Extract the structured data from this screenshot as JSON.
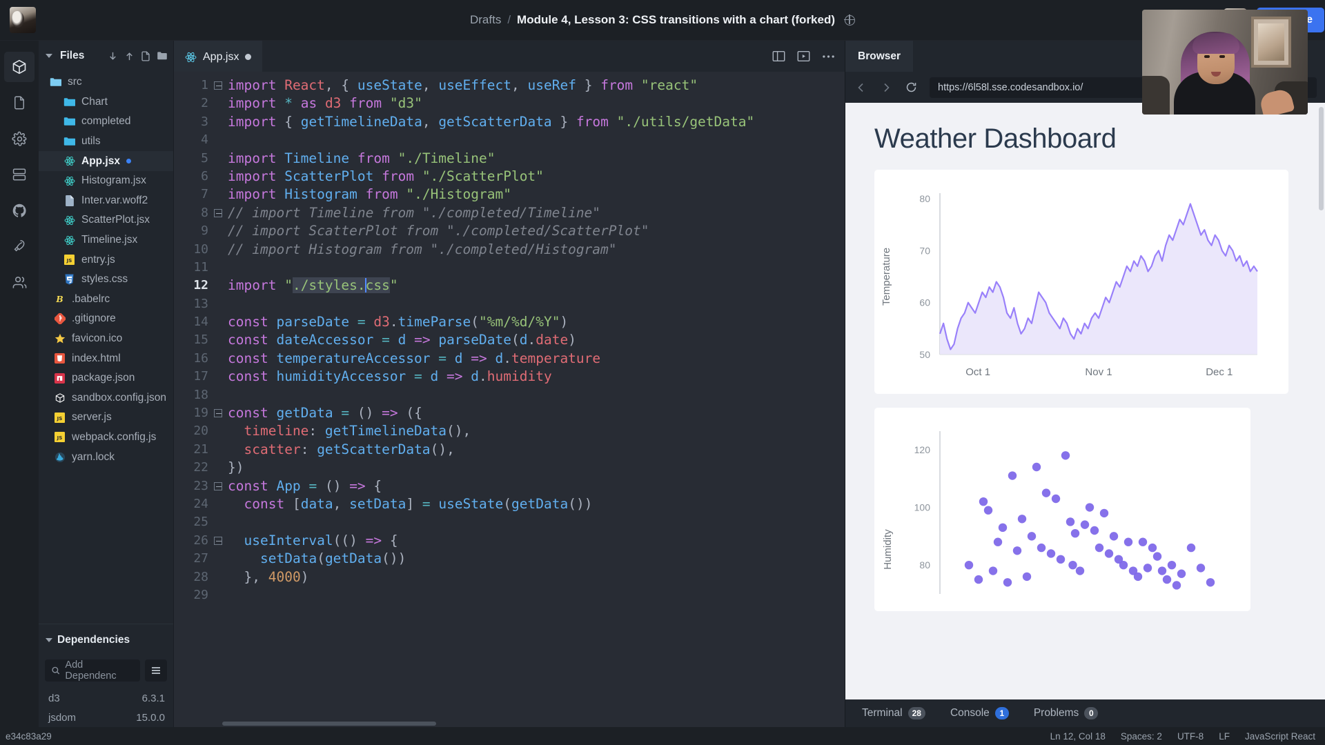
{
  "topbar": {
    "breadcrumb_root": "Drafts",
    "breadcrumb_sep": "/",
    "breadcrumb_title": "Module 4, Lesson 3: CSS transitions with a chart (forked)",
    "share_label": "Share"
  },
  "activitybar": {
    "items": [
      {
        "name": "sandbox-explorer-icon",
        "active": true
      },
      {
        "name": "files-icon",
        "active": false
      },
      {
        "name": "settings-gear-icon",
        "active": false
      },
      {
        "name": "server-control-icon",
        "active": false
      },
      {
        "name": "github-icon",
        "active": false
      },
      {
        "name": "deploy-rocket-icon",
        "active": false
      },
      {
        "name": "live-collaborators-icon",
        "active": false
      }
    ]
  },
  "sidebar": {
    "title": "Files",
    "actions": [
      "download-icon",
      "upload-icon",
      "new-file-icon",
      "new-folder-icon"
    ],
    "files": [
      {
        "label": "src",
        "icon": "folder-open",
        "indent": 0,
        "selected": false,
        "modified": false
      },
      {
        "label": "Chart",
        "icon": "folder",
        "indent": 1,
        "selected": false,
        "modified": false
      },
      {
        "label": "completed",
        "icon": "folder",
        "indent": 1,
        "selected": false,
        "modified": false
      },
      {
        "label": "utils",
        "icon": "folder",
        "indent": 1,
        "selected": false,
        "modified": false
      },
      {
        "label": "App.jsx",
        "icon": "react",
        "indent": 1,
        "selected": true,
        "modified": true
      },
      {
        "label": "Histogram.jsx",
        "icon": "react",
        "indent": 1,
        "selected": false,
        "modified": false
      },
      {
        "label": "Inter.var.woff2",
        "icon": "file",
        "indent": 1,
        "selected": false,
        "modified": false
      },
      {
        "label": "ScatterPlot.jsx",
        "icon": "react",
        "indent": 1,
        "selected": false,
        "modified": false
      },
      {
        "label": "Timeline.jsx",
        "icon": "react",
        "indent": 1,
        "selected": false,
        "modified": false
      },
      {
        "label": "entry.js",
        "icon": "js",
        "indent": 1,
        "selected": false,
        "modified": false
      },
      {
        "label": "styles.css",
        "icon": "css",
        "indent": 1,
        "selected": false,
        "modified": false
      },
      {
        "label": ".babelrc",
        "icon": "babel",
        "indent": 2,
        "selected": false,
        "modified": false
      },
      {
        "label": ".gitignore",
        "icon": "git",
        "indent": 2,
        "selected": false,
        "modified": false
      },
      {
        "label": "favicon.ico",
        "icon": "star",
        "indent": 2,
        "selected": false,
        "modified": false
      },
      {
        "label": "index.html",
        "icon": "html",
        "indent": 2,
        "selected": false,
        "modified": false
      },
      {
        "label": "package.json",
        "icon": "npm",
        "indent": 2,
        "selected": false,
        "modified": false
      },
      {
        "label": "sandbox.config.json",
        "icon": "codesandbox",
        "indent": 2,
        "selected": false,
        "modified": false
      },
      {
        "label": "server.js",
        "icon": "js",
        "indent": 2,
        "selected": false,
        "modified": false
      },
      {
        "label": "webpack.config.js",
        "icon": "js",
        "indent": 2,
        "selected": false,
        "modified": false
      },
      {
        "label": "yarn.lock",
        "icon": "yarn",
        "indent": 2,
        "selected": false,
        "modified": false
      }
    ],
    "dependencies": {
      "title": "Dependencies",
      "search_placeholder": "Add Dependenc",
      "items": [
        {
          "name": "d3",
          "version": "6.3.1"
        },
        {
          "name": "jsdom",
          "version": "15.0.0"
        }
      ]
    }
  },
  "editor": {
    "tab": {
      "label": "App.jsx",
      "icon": "react-icon",
      "modified": true
    },
    "actions": [
      "split-pane-icon",
      "preview-pane-icon",
      "more-options-icon"
    ],
    "lines": [
      {
        "n": "1",
        "fold": true,
        "cur": false
      },
      {
        "n": "2",
        "fold": false,
        "cur": false
      },
      {
        "n": "3",
        "fold": false,
        "cur": false
      },
      {
        "n": "4",
        "fold": false,
        "cur": false
      },
      {
        "n": "5",
        "fold": false,
        "cur": false
      },
      {
        "n": "6",
        "fold": false,
        "cur": false
      },
      {
        "n": "7",
        "fold": false,
        "cur": false
      },
      {
        "n": "8",
        "fold": true,
        "cur": false
      },
      {
        "n": "9",
        "fold": false,
        "cur": false
      },
      {
        "n": "10",
        "fold": false,
        "cur": false
      },
      {
        "n": "11",
        "fold": false,
        "cur": false
      },
      {
        "n": "12",
        "fold": false,
        "cur": true
      },
      {
        "n": "13",
        "fold": false,
        "cur": false
      },
      {
        "n": "14",
        "fold": false,
        "cur": false
      },
      {
        "n": "15",
        "fold": false,
        "cur": false
      },
      {
        "n": "16",
        "fold": false,
        "cur": false
      },
      {
        "n": "17",
        "fold": false,
        "cur": false
      },
      {
        "n": "18",
        "fold": false,
        "cur": false
      },
      {
        "n": "19",
        "fold": true,
        "cur": false
      },
      {
        "n": "20",
        "fold": false,
        "cur": false
      },
      {
        "n": "21",
        "fold": false,
        "cur": false
      },
      {
        "n": "22",
        "fold": false,
        "cur": false
      },
      {
        "n": "23",
        "fold": true,
        "cur": false
      },
      {
        "n": "24",
        "fold": false,
        "cur": false
      },
      {
        "n": "25",
        "fold": false,
        "cur": false
      },
      {
        "n": "26",
        "fold": true,
        "cur": false
      },
      {
        "n": "27",
        "fold": false,
        "cur": false
      },
      {
        "n": "28",
        "fold": false,
        "cur": false
      },
      {
        "n": "29",
        "fold": false,
        "cur": false
      }
    ],
    "source": [
      "import React, { useState, useEffect, useRef } from \"react\"",
      "import * as d3 from \"d3\"",
      "import { getTimelineData, getScatterData } from \"./utils/getData\"",
      "",
      "import Timeline from \"./Timeline\"",
      "import ScatterPlot from \"./ScatterPlot\"",
      "import Histogram from \"./Histogram\"",
      "// import Timeline from \"./completed/Timeline\"",
      "// import ScatterPlot from \"./completed/ScatterPlot\"",
      "// import Histogram from \"./completed/Histogram\"",
      "",
      "import \"./styles.css\"",
      "",
      "const parseDate = d3.timeParse(\"%m/%d/%Y\")",
      "const dateAccessor = d => parseDate(d.date)",
      "const temperatureAccessor = d => d.temperature",
      "const humidityAccessor = d => d.humidity",
      "",
      "const getData = () => ({",
      "  timeline: getTimelineData(),",
      "  scatter: getScatterData(),",
      "})",
      "const App = () => {",
      "  const [data, setData] = useState(getData())",
      "",
      "  useInterval(() => {",
      "    setData(getData())",
      "  }, 4000)",
      ""
    ]
  },
  "browser": {
    "tab_label": "Browser",
    "url": "https://6l58l.sse.codesandbox.io/",
    "nav": [
      "back-icon",
      "forward-icon",
      "reload-icon"
    ]
  },
  "preview": {
    "title": "Weather Dashboard"
  },
  "chart_data": [
    {
      "type": "area",
      "title": "Weather Dashboard",
      "ylabel": "Temperature",
      "xlabel": "",
      "ylim": [
        50,
        80
      ],
      "yticks": [
        50,
        60,
        70,
        80
      ],
      "xticks": [
        "Oct 1",
        "Nov 1",
        "Dec 1"
      ],
      "line_color": "#9980fa",
      "fill_color": "#ebe7fb",
      "grid": false,
      "x": [
        0,
        1,
        2,
        3,
        4,
        5,
        6,
        7,
        8,
        9,
        10,
        11,
        12,
        13,
        14,
        15,
        16,
        17,
        18,
        19,
        20,
        21,
        22,
        23,
        24,
        25,
        26,
        27,
        28,
        29,
        30,
        31,
        32,
        33,
        34,
        35,
        36,
        37,
        38,
        39,
        40,
        41,
        42,
        43,
        44,
        45,
        46,
        47,
        48,
        49,
        50,
        51,
        52,
        53,
        54,
        55,
        56,
        57,
        58,
        59,
        60,
        61,
        62,
        63,
        64,
        65,
        66,
        67,
        68,
        69,
        70,
        71,
        72,
        73,
        74,
        75,
        76,
        77,
        78,
        79,
        80,
        81,
        82,
        83,
        84,
        85,
        86,
        87,
        88,
        89,
        90
      ],
      "values": [
        54,
        56,
        53,
        51,
        52,
        55,
        57,
        58,
        60,
        59,
        58,
        60,
        62,
        61,
        63,
        62,
        64,
        63,
        61,
        58,
        57,
        59,
        56,
        54,
        55,
        57,
        56,
        59,
        62,
        61,
        60,
        58,
        57,
        56,
        55,
        57,
        56,
        54,
        53,
        55,
        54,
        56,
        55,
        57,
        58,
        57,
        59,
        61,
        60,
        62,
        64,
        63,
        65,
        67,
        66,
        68,
        67,
        69,
        68,
        66,
        67,
        69,
        70,
        68,
        71,
        73,
        72,
        74,
        76,
        75,
        77,
        79,
        77,
        75,
        73,
        74,
        72,
        71,
        73,
        72,
        70,
        69,
        71,
        70,
        68,
        69,
        67,
        68,
        66,
        67,
        66
      ]
    },
    {
      "type": "scatter",
      "title": "",
      "ylabel": "Humidity",
      "xlabel": "",
      "ylim": [
        70,
        125
      ],
      "yticks": [
        80,
        100,
        120
      ],
      "point_color": "#7c65e8",
      "grid": false,
      "points": [
        [
          18,
          102
        ],
        [
          20,
          99
        ],
        [
          30,
          111
        ],
        [
          40,
          114
        ],
        [
          52,
          118
        ],
        [
          44,
          105
        ],
        [
          48,
          103
        ],
        [
          34,
          96
        ],
        [
          26,
          93
        ],
        [
          38,
          90
        ],
        [
          24,
          88
        ],
        [
          42,
          86
        ],
        [
          46,
          84
        ],
        [
          50,
          82
        ],
        [
          55,
          80
        ],
        [
          58,
          78
        ],
        [
          60,
          94
        ],
        [
          64,
          92
        ],
        [
          66,
          86
        ],
        [
          70,
          84
        ],
        [
          74,
          82
        ],
        [
          76,
          80
        ],
        [
          80,
          78
        ],
        [
          84,
          88
        ],
        [
          88,
          86
        ],
        [
          92,
          78
        ],
        [
          96,
          80
        ],
        [
          100,
          77
        ],
        [
          36,
          76
        ],
        [
          28,
          74
        ],
        [
          22,
          78
        ],
        [
          16,
          75
        ],
        [
          62,
          100
        ],
        [
          68,
          98
        ],
        [
          72,
          90
        ],
        [
          78,
          88
        ],
        [
          82,
          76
        ],
        [
          86,
          79
        ],
        [
          90,
          83
        ],
        [
          94,
          75
        ],
        [
          54,
          95
        ],
        [
          56,
          91
        ],
        [
          32,
          85
        ],
        [
          12,
          80
        ],
        [
          104,
          86
        ],
        [
          108,
          79
        ],
        [
          112,
          74
        ],
        [
          98,
          73
        ]
      ]
    }
  ],
  "bottom_tabs": [
    {
      "label": "Terminal",
      "badge": "28",
      "badge_style": "grey"
    },
    {
      "label": "Console",
      "badge": "1",
      "badge_style": "blue"
    },
    {
      "label": "Problems",
      "badge": "0",
      "badge_style": "grey"
    }
  ],
  "statusbar": {
    "commit": "e34c83a29",
    "cursor": "Ln 12, Col 18",
    "spaces": "Spaces: 2",
    "encoding": "UTF-8",
    "eol": "LF",
    "language": "JavaScript React"
  }
}
